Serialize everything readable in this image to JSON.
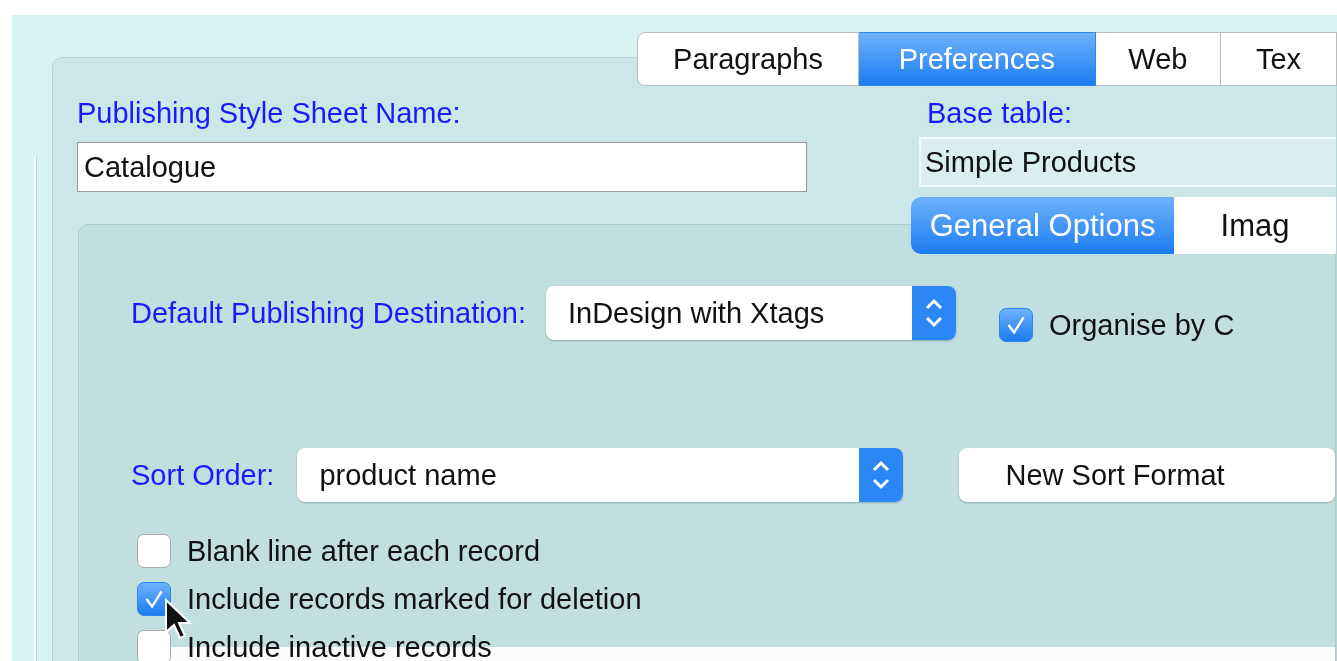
{
  "tabs": [
    {
      "label": "Paragraphs",
      "selected": false
    },
    {
      "label": "Preferences",
      "selected": true
    },
    {
      "label": "Web",
      "selected": false
    },
    {
      "label": "Tex",
      "selected": false
    }
  ],
  "style_sheet_name": {
    "label": "Publishing Style Sheet Name:",
    "value": "Catalogue"
  },
  "base_table": {
    "label": "Base table:",
    "value": "Simple Products"
  },
  "option_tabs": [
    {
      "label": "General Options",
      "selected": true
    },
    {
      "label": "Imag",
      "selected": false
    }
  ],
  "destination": {
    "label": "Default Publishing Destination:",
    "value": "InDesign with Xtags"
  },
  "organise_checkbox": {
    "label": "Organise by C",
    "checked": true
  },
  "sort_order": {
    "label": "Sort Order:",
    "value": "product name"
  },
  "new_sort_format_button": "New Sort Format",
  "checkboxes": [
    {
      "label": "Blank line after each record",
      "checked": false
    },
    {
      "label": "Include records marked for deletion",
      "checked": true
    },
    {
      "label": "Include inactive records",
      "checked": false
    }
  ]
}
